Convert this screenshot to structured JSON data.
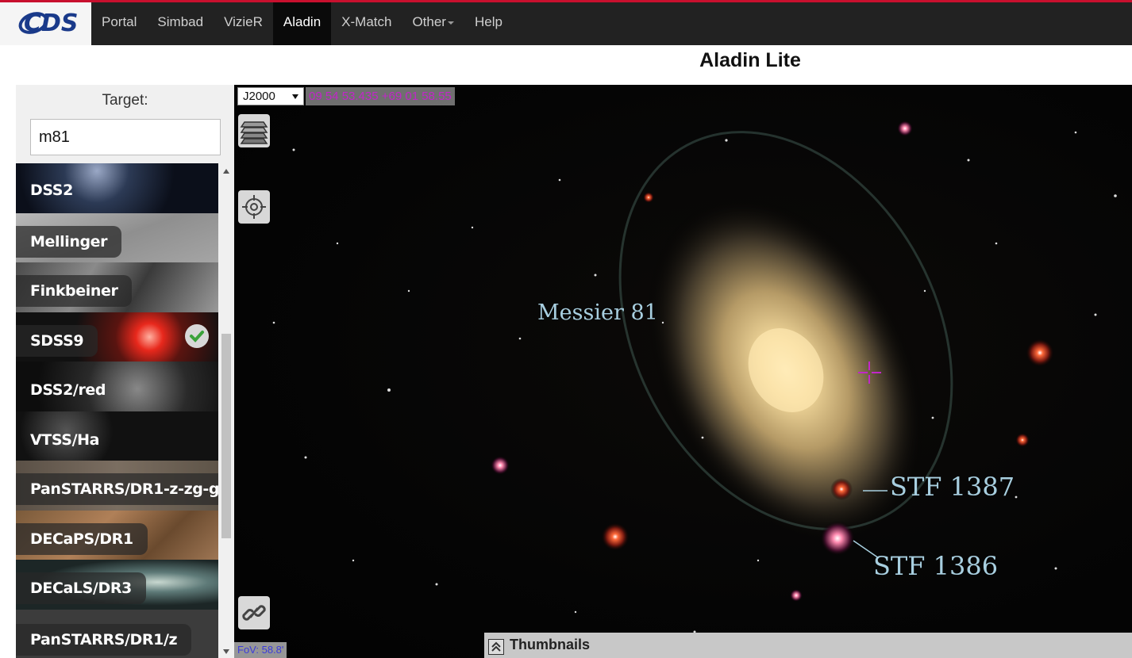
{
  "nav": {
    "logo": "CDS",
    "items": [
      "Portal",
      "Simbad",
      "VizieR",
      "Aladin",
      "X-Match",
      "Other",
      "Help"
    ],
    "active": "Aladin"
  },
  "page_title": "Aladin Lite",
  "target": {
    "label": "Target:",
    "value": "m81"
  },
  "surveys": [
    {
      "label": "DSS2",
      "selected": false
    },
    {
      "label": "Mellinger",
      "selected": false
    },
    {
      "label": "Finkbeiner",
      "selected": false
    },
    {
      "label": "SDSS9",
      "selected": true
    },
    {
      "label": "DSS2/red",
      "selected": false
    },
    {
      "label": "VTSS/Ha",
      "selected": false
    },
    {
      "label": "PanSTARRS/DR1-z-zg-g",
      "selected": false
    },
    {
      "label": "DECaPS/DR1",
      "selected": false
    },
    {
      "label": "DECaLS/DR3",
      "selected": false
    },
    {
      "label": "PanSTARRS/DR1/z",
      "selected": false
    }
  ],
  "sky": {
    "frame": "J2000",
    "coords": "09 54 53.435 +69 01 58.55",
    "fov": "FoV: 58.8'",
    "thumbnails": "Thumbnails",
    "annotations": {
      "messier": "Messier 81",
      "stf1387": "STF 1387",
      "stf1386": "STF 1386"
    }
  },
  "colors": {
    "nav_bg": "#222222",
    "nav_accent": "#c8102e",
    "coords_text": "#c226c9",
    "fov_text": "#3b3bdb",
    "annotation": "#a8cfe0"
  }
}
